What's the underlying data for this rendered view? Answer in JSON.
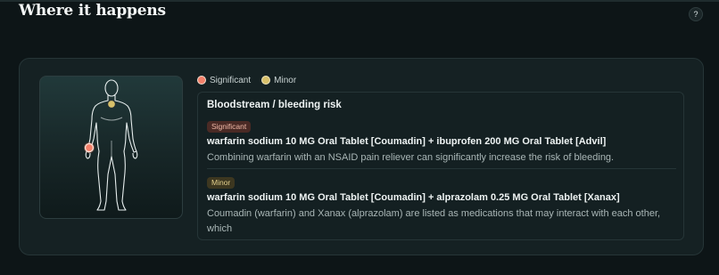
{
  "section": {
    "title": "Where it happens",
    "help_label": "?"
  },
  "legend": {
    "significant_label": "Significant",
    "minor_label": "Minor"
  },
  "colors": {
    "significant": "#f3806a",
    "minor": "#d8c06a"
  },
  "body_map": {
    "markers": [
      {
        "severity": "significant",
        "location": "left hand"
      },
      {
        "severity": "minor",
        "location": "chest"
      }
    ]
  },
  "region": {
    "title": "Bloodstream / bleeding risk",
    "interactions": [
      {
        "severity_label": "Significant",
        "pair": "warfarin sodium 10 MG Oral Tablet [Coumadin] + ibuprofen 200 MG Oral Tablet [Advil]",
        "description": "Combining warfarin with an NSAID pain reliever can significantly increase the risk of bleeding."
      },
      {
        "severity_label": "Minor",
        "pair": "warfarin sodium 10 MG Oral Tablet [Coumadin] + alprazolam 0.25 MG Oral Tablet [Xanax]",
        "description": "Coumadin (warfarin) and Xanax (alprazolam) are listed as medications that may interact with each other, which"
      }
    ]
  }
}
